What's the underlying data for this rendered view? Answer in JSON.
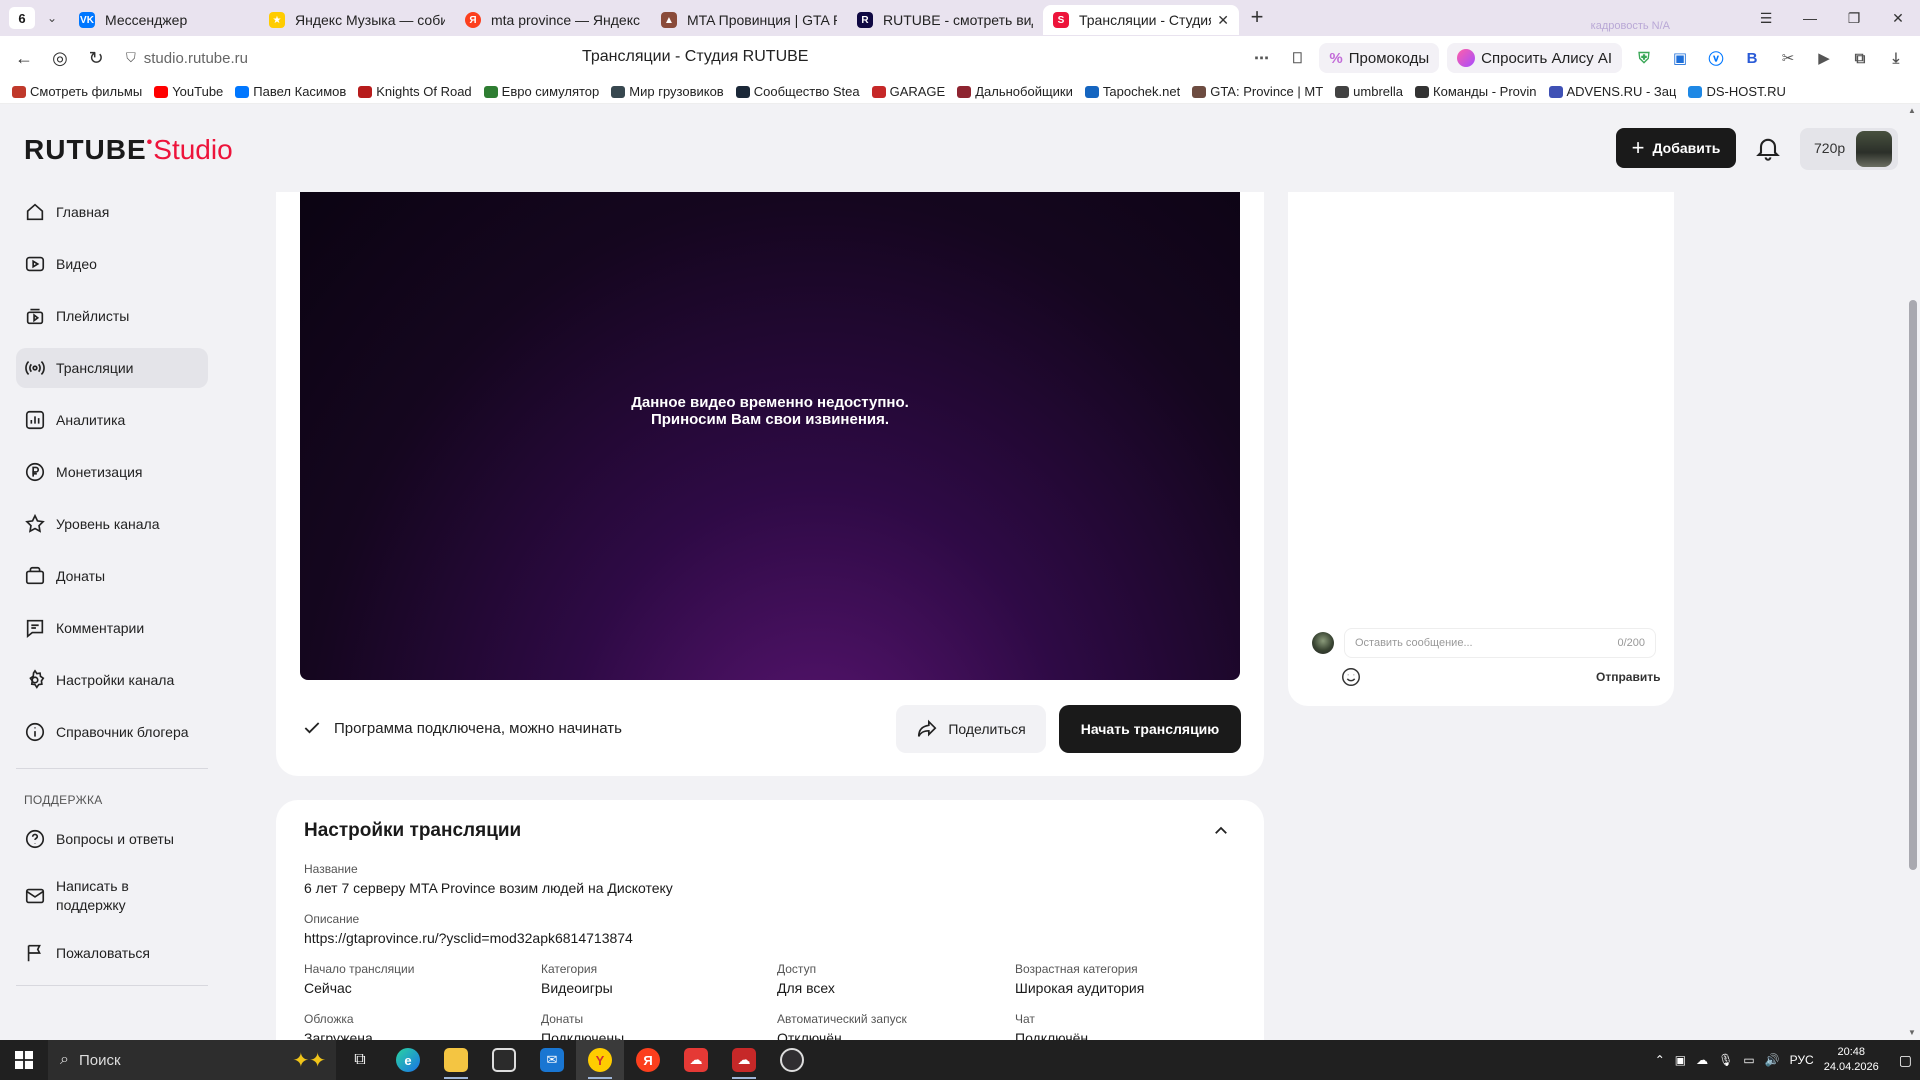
{
  "browser": {
    "tab_count": "6",
    "tabs": [
      {
        "title": "Мессенджер",
        "color": "#0077ff",
        "icon": "vk-icon"
      },
      {
        "title": "Яндекс Музыка — собира",
        "color": "#ffcc00",
        "icon": "yandex-music-icon"
      },
      {
        "title": "mta province — Яндекс: н",
        "color": "#fc3f1d",
        "icon": "yandex-search-icon"
      },
      {
        "title": "MTA Провинция | GTA Pr",
        "color": "#8a4b3a",
        "icon": "mta-icon"
      },
      {
        "title": "RUTUBE - смотреть виде",
        "color": "#100943",
        "icon": "rutube-icon"
      },
      {
        "title": "Трансляции - Студия R",
        "color": "#ed143b",
        "icon": "rutube-studio-icon"
      }
    ],
    "kadrovost_label": "кадровость N/A",
    "url": "studio.rutube.ru",
    "page_title": "Трансляции - Студия RUTUBE",
    "promo_label": "Промокоды",
    "alice_label": "Спросить Алису AI",
    "bookmarks": [
      {
        "label": "Смотреть фильмы",
        "color": "#c0392b"
      },
      {
        "label": "YouTube",
        "color": "#ff0000"
      },
      {
        "label": "Павел Касимов",
        "color": "#0077ff"
      },
      {
        "label": "Knights Of Road",
        "color": "#b71c1c"
      },
      {
        "label": "Евро симулятор",
        "color": "#2e7d32"
      },
      {
        "label": "Мир грузовиков",
        "color": "#37474f"
      },
      {
        "label": "Сообщество Stea",
        "color": "#1b2838"
      },
      {
        "label": "GARAGE",
        "color": "#c62828"
      },
      {
        "label": "Дальнобойщики",
        "color": "#8e2430"
      },
      {
        "label": "Tapochek.net",
        "color": "#1565c0"
      },
      {
        "label": "GTA: Province | MT",
        "color": "#6d4c41"
      },
      {
        "label": "umbrella",
        "color": "#424242"
      },
      {
        "label": "Команды - Provin",
        "color": "#333333"
      },
      {
        "label": "ADVENS.RU - Зац",
        "color": "#3f51b5"
      },
      {
        "label": "DS-HOST.RU",
        "color": "#1e88e5"
      }
    ]
  },
  "header": {
    "logo_main": "RUTUBE",
    "logo_studio": "Studio",
    "add_label": "Добавить",
    "quality": "720p"
  },
  "sidebar": {
    "items": [
      {
        "label": "Главная",
        "icon": "home-icon"
      },
      {
        "label": "Видео",
        "icon": "video-icon"
      },
      {
        "label": "Плейлисты",
        "icon": "playlist-icon"
      },
      {
        "label": "Трансляции",
        "icon": "broadcast-icon"
      },
      {
        "label": "Аналитика",
        "icon": "analytics-icon"
      },
      {
        "label": "Монетизация",
        "icon": "ruble-icon"
      },
      {
        "label": "Уровень канала",
        "icon": "star-icon"
      },
      {
        "label": "Донаты",
        "icon": "wallet-icon"
      },
      {
        "label": "Комментарии",
        "icon": "comment-icon"
      },
      {
        "label": "Настройки канала",
        "icon": "gear-icon"
      },
      {
        "label": "Справочник блогера",
        "icon": "info-icon"
      }
    ],
    "support_title": "ПОДДЕРЖКА",
    "support_items": [
      {
        "label": "Вопросы и ответы",
        "icon": "question-icon"
      },
      {
        "label": "Написать в поддержку",
        "icon": "mail-icon"
      },
      {
        "label": "Пожаловаться",
        "icon": "flag-icon"
      }
    ]
  },
  "player": {
    "message_line1": "Данное видео временно недоступно.",
    "message_line2": "Приносим Вам свои извинения.",
    "status": "Программа подключена, можно начинать",
    "share_label": "Поделиться",
    "start_label": "Начать трансляцию"
  },
  "chat": {
    "placeholder": "Оставить сообщение...",
    "counter": "0/200",
    "send_label": "Отправить"
  },
  "settings": {
    "title": "Настройки трансляции",
    "name_label": "Название",
    "name_value": "6 лет 7 серверу MTA Province возим людей на Дискотеку",
    "desc_label": "Описание",
    "desc_value": "https://gtaprovince.ru/?ysclid=mod32apk6814713874",
    "grid": [
      {
        "label": "Начало трансляции",
        "value": "Сейчас"
      },
      {
        "label": "Категория",
        "value": "Видеоигры"
      },
      {
        "label": "Доступ",
        "value": "Для всех"
      },
      {
        "label": "Возрастная категория",
        "value": "Широкая аудитория"
      },
      {
        "label": "Обложка",
        "value": "Загружена"
      },
      {
        "label": "Донаты",
        "value": "Подключены"
      },
      {
        "label": "Автоматический запуск",
        "value": "Отключён"
      },
      {
        "label": "Чат",
        "value": "Подключён"
      }
    ]
  },
  "taskbar": {
    "search_label": "Поиск",
    "lang": "РУС",
    "time": "20:48",
    "date": "24.04.2026"
  }
}
